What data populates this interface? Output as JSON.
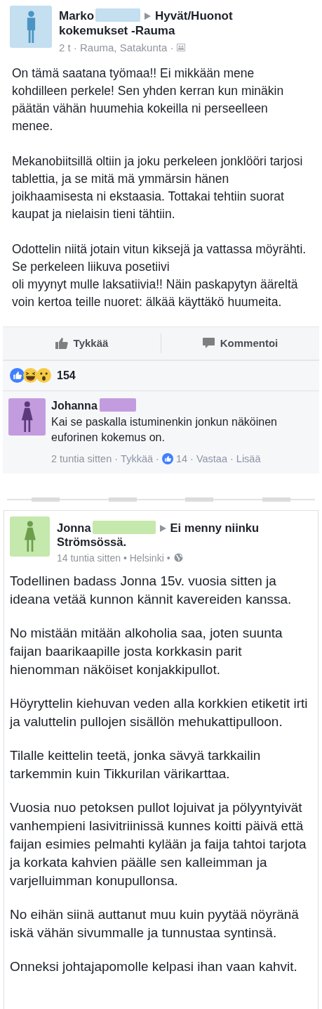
{
  "posts": [
    {
      "author": "Marko",
      "color": "#c3dff0",
      "avatar": {
        "kind": "man"
      },
      "target": "Hyvät/Huonot kokemukset -Rauma",
      "meta": "2 t · Rauma, Satakunta ·",
      "audience": {
        "kind": "group"
      },
      "paragraphs": [
        "On tämä saatana työmaa!! Ei mikkään mene kohdilleen perkele! Sen yhden kerran kun minäkin päätän vähän huumehia kokeilla ni perseelleen menee.",
        "Mekanobiitsillä oltiin ja joku perkeleen jonklööri tarjosi tablettia, ja se mitä mä ymmärsin hänen joikhaamisesta ni ekstaasia. Tottakai tehtiin suorat kaupat ja nielaisin tieni tähtiin.",
        "Odottelin niitä jotain vitun kiksejä ja vattassa möyrähti. Se perkeleen liikuva posetiivi\noli myynyt mulle laksatiivia!! Näin paskapytyn ääreltä voin kertoa teille nuoret: älkää käyttäkö huumeita."
      ],
      "actions": [
        {
          "kind": "like",
          "label": "Tykkää"
        },
        {
          "kind": "comment",
          "label": "Kommentoi"
        }
      ],
      "reactions": {
        "count": "154"
      },
      "comments": [
        {
          "author": "Johanna",
          "color": "#c39ce0",
          "avatar": {
            "kind": "woman"
          },
          "text": "Kai se paskalla istuminenkin jonkun näköinen euforinen kokemus on.",
          "footer": [
            {
              "kind": "text",
              "text": "2 tuntia sitten ·"
            },
            {
              "kind": "link",
              "text": "Tykkää"
            },
            {
              "kind": "text",
              "text": "·"
            },
            {
              "kind": "likes",
              "text": "14 ·"
            },
            {
              "kind": "link",
              "text": "Vastaa"
            },
            {
              "kind": "text",
              "text": "·"
            },
            {
              "kind": "link",
              "text": "Lisää"
            }
          ]
        }
      ]
    },
    {
      "author": "Jonna",
      "color": "#c5e8ad",
      "avatar": {
        "kind": "woman"
      },
      "target": "Ei menny niinku Strömsössä.",
      "meta": "14 tuntia sitten • Helsinki •",
      "audience": {
        "kind": "public"
      },
      "paragraphs": [
        "Todellinen badass Jonna 15v. vuosia sitten ja ideana vetää kunnon kännit kavereiden kanssa.",
        "No mistään mitään alkoholia saa, joten suunta faijan baarikaapille josta korkkasin parit hienomman näköiset konjakkipullot.",
        "Höyryttelin kiehuvan veden alla korkkien etiketit irti ja valuttelin pullojen sisällön mehukattipulloon.",
        "Tilalle keittelin teetä, jonka sävyä tarkkailin tarkemmin kuin Tikkurilan värikarttaa.",
        "Vuosia nuo petoksen pullot lojuivat ja pölyyntyivät vanhempieni lasivitriinissä kunnes koitti päivä että faijan esimies pelmahti kylään ja faija tahtoi tarjota ja korkata kahvien päälle sen kalleimman ja varjelluimman konupullonsa.",
        "No eihän siinä auttanut muu kuin pyytää nöyränä iskä vähän sivummalle ja tunnustaa syntinsä.",
        "Onneksi johtajapomolle kelpasi ihan vaan kahvit."
      ]
    }
  ]
}
